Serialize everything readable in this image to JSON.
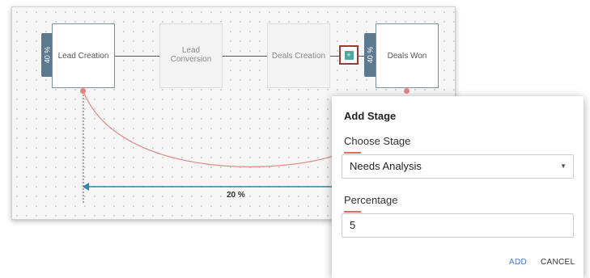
{
  "flow": {
    "stages": [
      {
        "name": "Lead Creation"
      },
      {
        "name": "Lead Conversion"
      },
      {
        "name": "Deals Creation"
      },
      {
        "name": "Deals Won"
      }
    ],
    "left_percentage_tab": "40 %",
    "right_percentage_tab": "40 %",
    "conversion_percentage": "20 %",
    "add_stage_icon": "plus-icon"
  },
  "dialog": {
    "title": "Add Stage",
    "choose_stage_label": "Choose Stage",
    "choose_stage_value": "Needs Analysis",
    "percentage_label": "Percentage",
    "percentage_value": "5",
    "add_button": "ADD",
    "cancel_button": "CANCEL"
  },
  "colors": {
    "accent": "#e06c5c",
    "primary_button": "#3a7bd5",
    "percentage_tab": "#5b7a90",
    "arrow": "#2f86b0",
    "arc": "#e0918a",
    "highlight_border": "#9b3a35"
  }
}
